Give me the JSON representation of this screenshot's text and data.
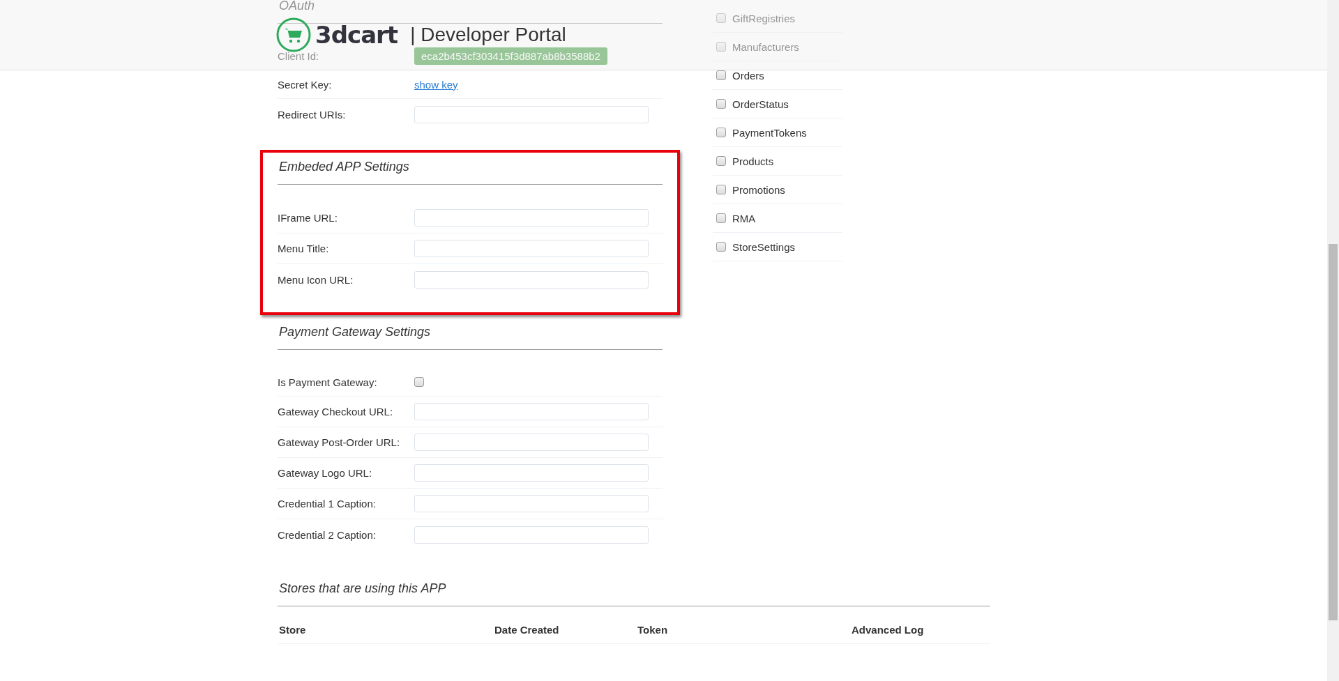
{
  "header": {
    "logo_text": "3dcart",
    "title": "| Developer Portal"
  },
  "sections": [
    {
      "heading": "OAuth",
      "highlighted": false,
      "fields": [
        {
          "kind": "value",
          "label": "Client Id:",
          "value": "eca2b453cf303415f3d887ab8b3588b2"
        },
        {
          "kind": "link",
          "label": "Secret Key:",
          "value": "show key"
        },
        {
          "kind": "input",
          "label": "Redirect URIs:"
        }
      ]
    },
    {
      "heading": "Embeded APP Settings",
      "highlighted": true,
      "fields": [
        {
          "kind": "input",
          "label": "IFrame URL:"
        },
        {
          "kind": "input",
          "label": "Menu Title:"
        },
        {
          "kind": "input",
          "label": "Menu Icon URL:"
        }
      ]
    },
    {
      "heading": "Payment Gateway Settings",
      "highlighted": false,
      "fields": [
        {
          "kind": "checkbox",
          "label": "Is Payment Gateway:",
          "checked": false
        },
        {
          "kind": "input",
          "label": "Gateway Checkout URL:"
        },
        {
          "kind": "input",
          "label": "Gateway Post-Order URL:"
        },
        {
          "kind": "input",
          "label": "Gateway Logo URL:"
        },
        {
          "kind": "input",
          "label": "Credential 1 Caption:"
        },
        {
          "kind": "input",
          "label": "Credential 2 Caption:"
        }
      ]
    }
  ],
  "permissions": [
    {
      "label": "GiftRegistries",
      "checked": false
    },
    {
      "label": "Manufacturers",
      "checked": false
    },
    {
      "label": "Orders",
      "checked": false
    },
    {
      "label": "OrderStatus",
      "checked": false
    },
    {
      "label": "PaymentTokens",
      "checked": false
    },
    {
      "label": "Products",
      "checked": false
    },
    {
      "label": "Promotions",
      "checked": false
    },
    {
      "label": "RMA",
      "checked": false
    },
    {
      "label": "StoreSettings",
      "checked": false
    }
  ],
  "stores": {
    "heading": "Stores that are using this APP",
    "columns": [
      "Store",
      "Date Created",
      "Token",
      "Advanced Log"
    ]
  }
}
